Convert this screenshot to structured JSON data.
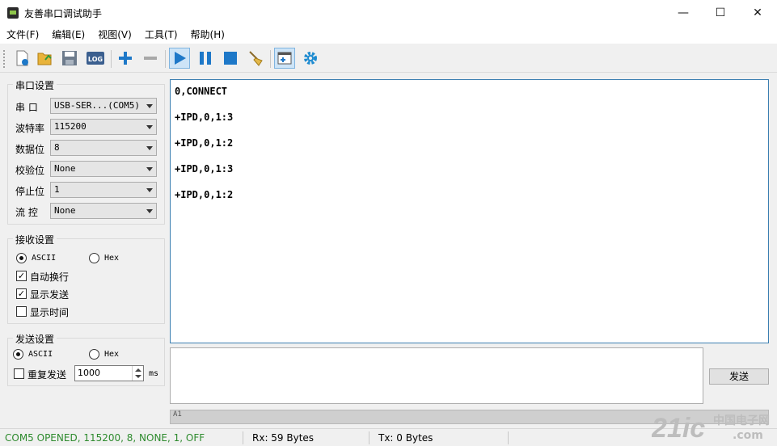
{
  "window": {
    "title": "友善串口调试助手",
    "controls": {
      "minimize": "—",
      "maximize": "☐",
      "close": "✕"
    }
  },
  "menu": [
    "文件(F)",
    "编辑(E)",
    "视图(V)",
    "工具(T)",
    "帮助(H)"
  ],
  "toolbar": {
    "icons": [
      "new-icon",
      "open-icon",
      "save-icon",
      "log-icon",
      "add-icon",
      "remove-icon",
      "play-icon",
      "pause-icon",
      "stop-icon",
      "clear-icon",
      "window-icon",
      "settings-icon"
    ],
    "log_label": "LOG"
  },
  "serial_settings": {
    "title": "串口设置",
    "fields": [
      {
        "label": "串  口",
        "value": "USB-SER...(COM5)"
      },
      {
        "label": "波特率",
        "value": "115200"
      },
      {
        "label": "数据位",
        "value": "8"
      },
      {
        "label": "校验位",
        "value": "None"
      },
      {
        "label": "停止位",
        "value": "1"
      },
      {
        "label": "流  控",
        "value": "None"
      }
    ]
  },
  "receive_settings": {
    "title": "接收设置",
    "ascii": "ASCII",
    "hex": "Hex",
    "selected": "ASCII",
    "auto_newline": "自动换行",
    "show_send": "显示发送",
    "show_time": "显示时间"
  },
  "send_settings": {
    "title": "发送设置",
    "ascii": "ASCII",
    "hex": "Hex",
    "selected": "ASCII",
    "repeat": "重复发送",
    "interval": "1000",
    "unit": "ms"
  },
  "receive_text": [
    "0,CONNECT",
    "+IPD,0,1:3",
    "+IPD,0,1:2",
    "+IPD,0,1:3",
    "+IPD,0,1:2"
  ],
  "send_button": "发送",
  "strip_text": "A1",
  "status": {
    "port": "COM5 OPENED, 115200, 8, NONE, 1, OFF",
    "rx": "Rx: 59 Bytes",
    "tx": "Tx: 0 Bytes"
  },
  "watermark": {
    "brand": "21ic",
    "cn": "中国电子网",
    "site": ".com"
  },
  "colors": {
    "status_green": "#2e8b2e",
    "accent_blue": "#3c7fb1",
    "icon_blue": "#1e78c8"
  }
}
